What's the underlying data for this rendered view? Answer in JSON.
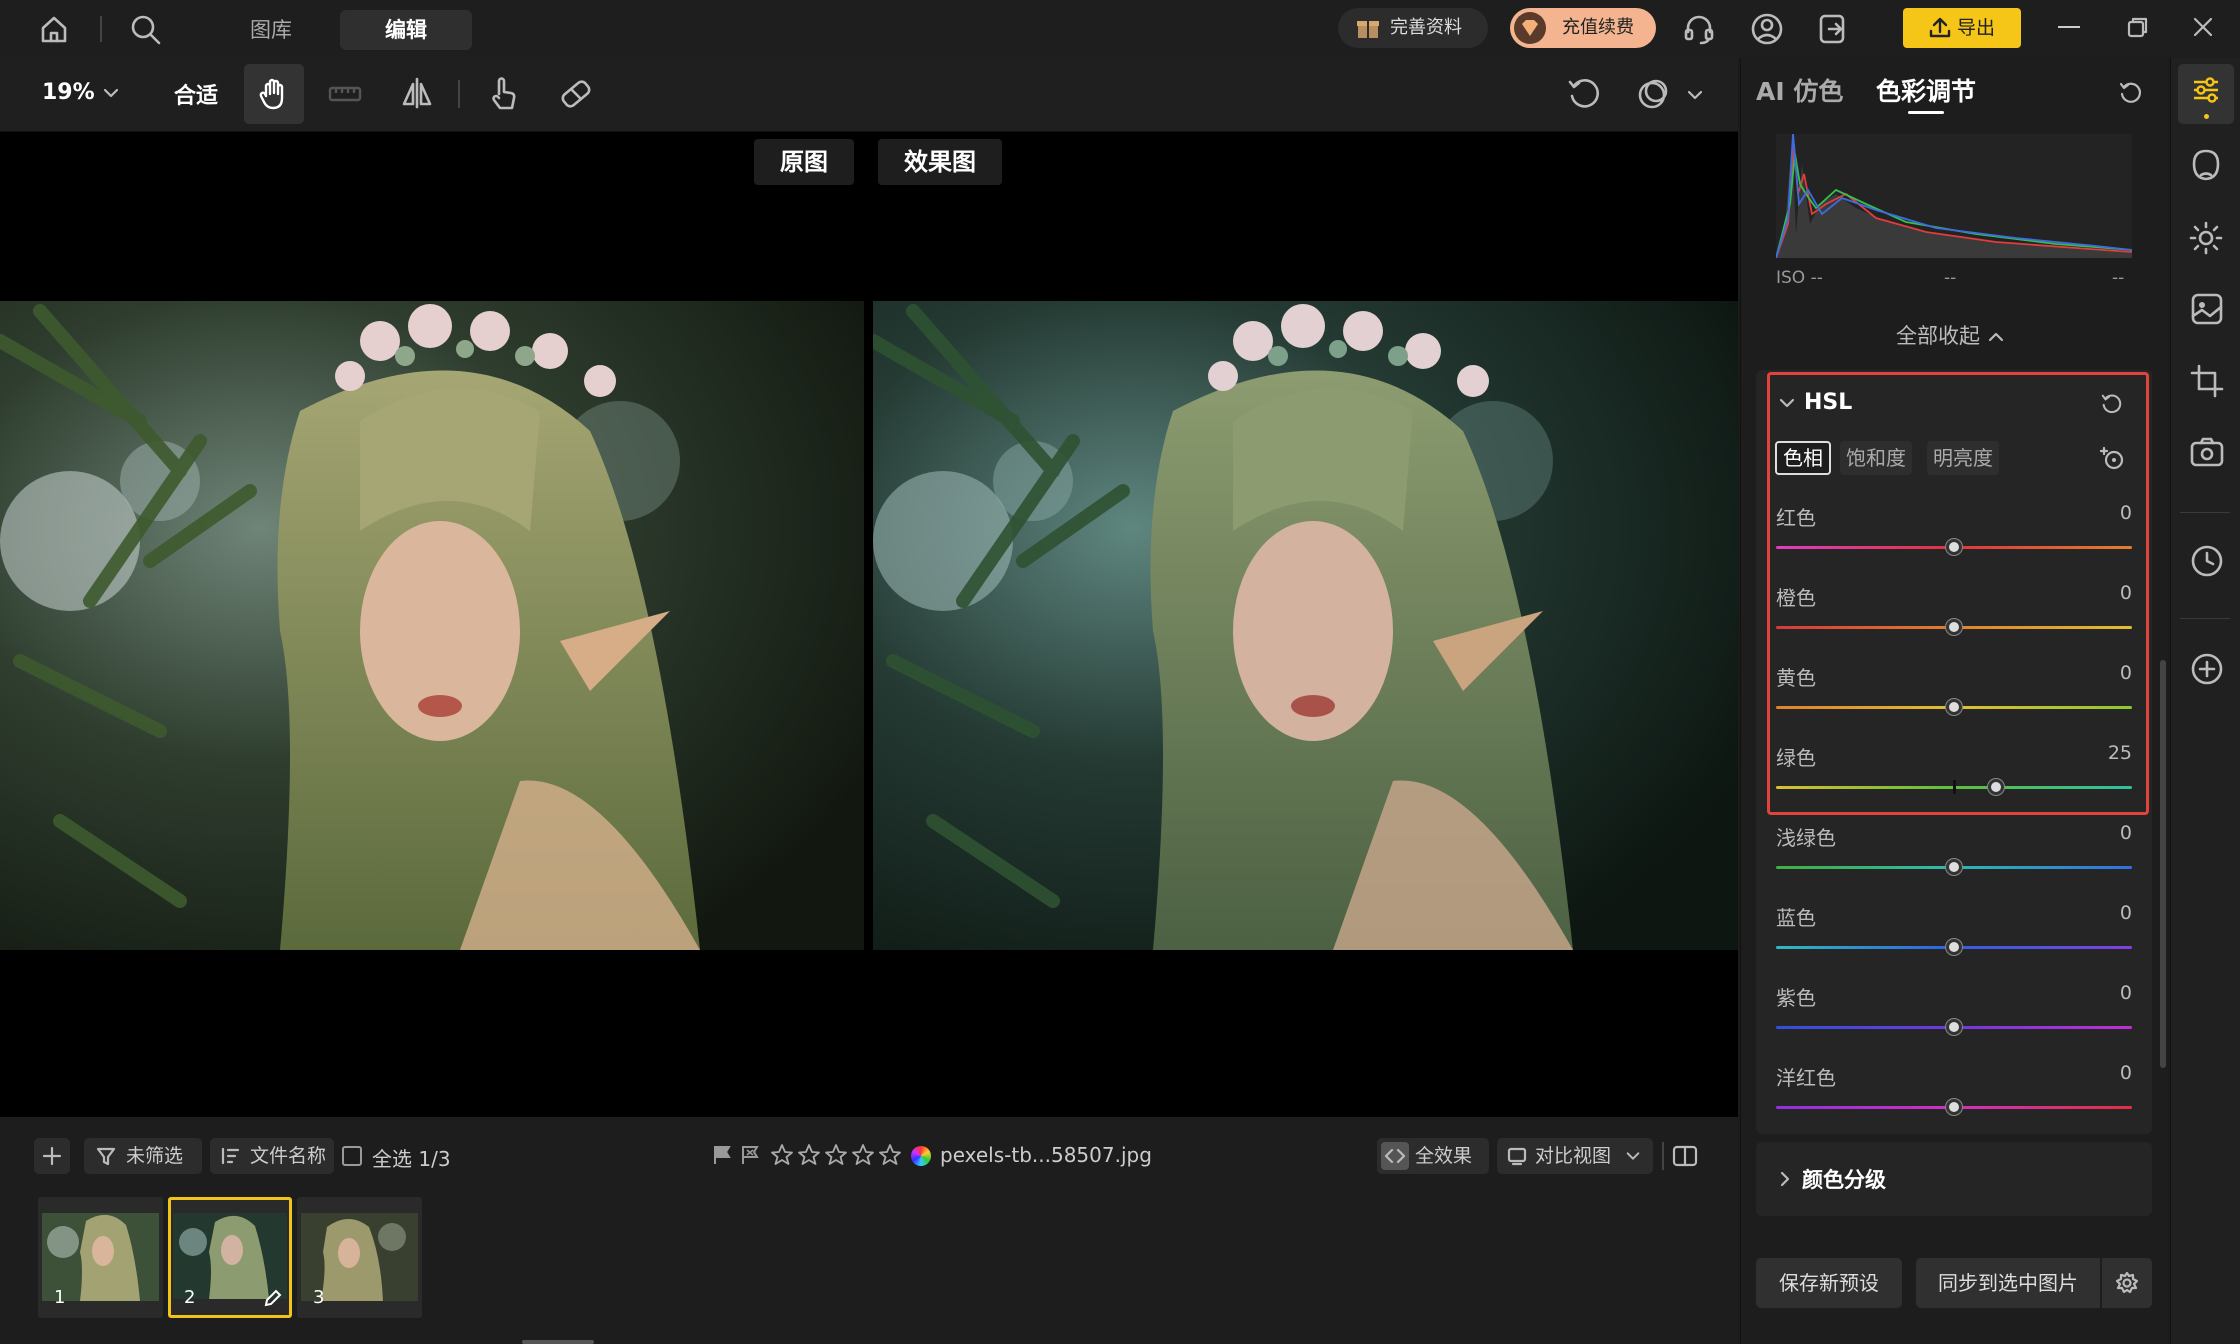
{
  "topbar": {
    "tabs": [
      {
        "label": "图库"
      },
      {
        "label": "编辑"
      }
    ],
    "profile_label": "完善资料",
    "recharge_label": "充值续费",
    "export_label": "导出"
  },
  "toolbar": {
    "zoom": "19%",
    "fit_label": "合适"
  },
  "panel": {
    "tabs": [
      {
        "label": "AI 仿色"
      },
      {
        "label": "色彩调节"
      }
    ],
    "histogram": {
      "iso": "ISO --",
      "b": "--",
      "c": "--"
    },
    "collapse_label": "全部收起",
    "hsl": {
      "title": "HSL",
      "tabs": [
        {
          "label": "色相"
        },
        {
          "label": "饱和度"
        },
        {
          "label": "明亮度"
        }
      ],
      "sliders": [
        {
          "label": "红色",
          "value": "0"
        },
        {
          "label": "橙色",
          "value": "0"
        },
        {
          "label": "黄色",
          "value": "0"
        },
        {
          "label": "绿色",
          "value": "25"
        },
        {
          "label": "浅绿色",
          "value": "0"
        },
        {
          "label": "蓝色",
          "value": "0"
        },
        {
          "label": "紫色",
          "value": "0"
        },
        {
          "label": "洋红色",
          "value": "0"
        }
      ]
    },
    "grading_title": "颜色分级",
    "save_preset_label": "保存新预设",
    "sync_label": "同步到选中图片"
  },
  "canvas": {
    "original_label": "原图",
    "effect_label": "效果图"
  },
  "bottombar": {
    "filter_label": "未筛选",
    "sort_label": "文件名称",
    "select_all_label": "全选 1/3",
    "filename": "pexels-tb...58507.jpg",
    "all_effect_label": "全效果",
    "compare_label": "对比视图",
    "thumbnails": [
      {
        "number": "1"
      },
      {
        "number": "2"
      },
      {
        "number": "3"
      }
    ]
  },
  "colors": {
    "accent": "#f5c518",
    "highlight": "#e0443c",
    "selected_thumb": "#f0c419"
  }
}
